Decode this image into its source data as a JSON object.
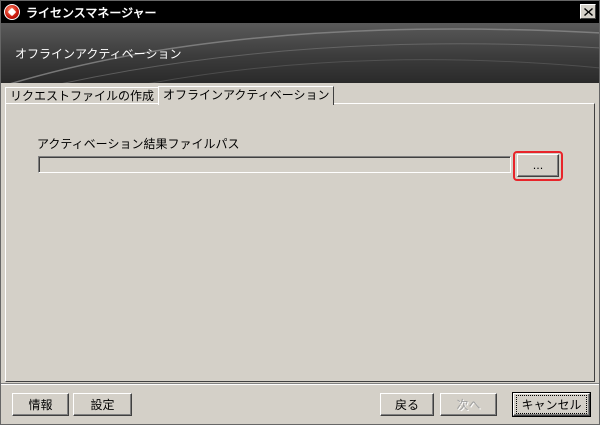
{
  "window": {
    "title": "ライセンスマネージャー",
    "close_icon": "close-icon",
    "app_icon": "license-manager-icon"
  },
  "banner": {
    "title": "オフラインアクティベーション"
  },
  "tabs": [
    {
      "label": "リクエストファイルの作成",
      "active": false
    },
    {
      "label": "オフラインアクティベーション",
      "active": true
    }
  ],
  "form": {
    "path_label": "アクティベーション結果ファイルパス",
    "path_value": "",
    "browse_label": "..."
  },
  "buttons": {
    "info": "情報",
    "settings": "設定",
    "back": "戻る",
    "next": "次へ",
    "cancel": "キャンセル"
  },
  "colors": {
    "highlight": "#e8242a",
    "banner": "#3c3c3c",
    "titlebar": "#000000",
    "face": "#d4d0c8"
  }
}
